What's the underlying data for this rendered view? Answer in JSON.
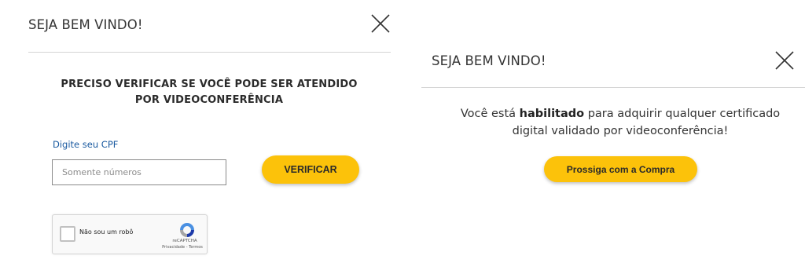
{
  "left_modal": {
    "title": "SEJA BEM VINDO!",
    "close_icon": "close-icon",
    "heading_line1": "PRECISO VERIFICAR SE VOCÊ PODE SER ATENDIDO",
    "heading_line2": "POR VIDEOCONFERÊNCIA",
    "cpf_label": "Digite seu CPF",
    "cpf_placeholder": "Somente números",
    "cpf_value": "",
    "verify_button": "VERIFICAR",
    "recaptcha": {
      "label": "Não sou um robô",
      "brand": "reCAPTCHA",
      "terms": "Privacidade - Termos",
      "logo_icon": "recaptcha-logo-icon",
      "checked": false
    }
  },
  "right_modal": {
    "title": "SEJA BEM VINDO!",
    "close_icon": "close-icon",
    "message_prefix": "Você está ",
    "message_bold": "habilitado",
    "message_suffix": " para adquirir qualquer certificado",
    "message_line2": "digital validado por videoconferência!",
    "proceed_button": "Prossiga com a Compra"
  },
  "colors": {
    "accent_button": "#fcc20a",
    "link_label": "#1a5aa0",
    "divider": "#d4d4d4",
    "text": "#333333"
  }
}
